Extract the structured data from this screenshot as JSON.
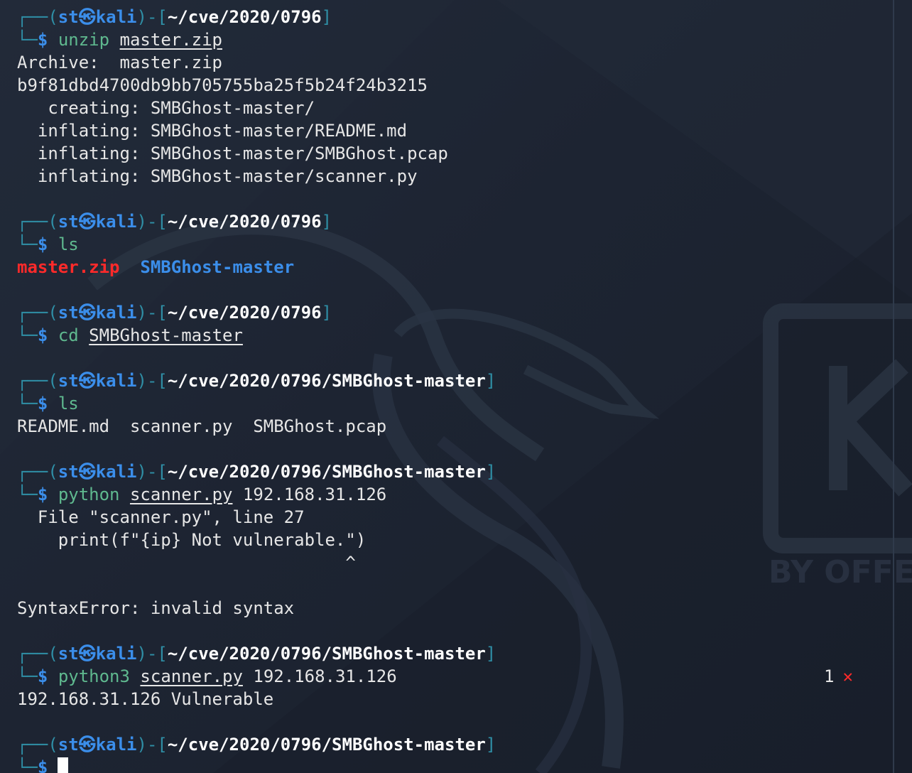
{
  "prompt": {
    "open": "┌──(",
    "user": "st",
    "at": "㉿",
    "host": "kali",
    "mid": ")-[",
    "close": "]",
    "corner": "└─",
    "dollar": "$"
  },
  "blocks": [
    {
      "path": "~/cve/2020/0796",
      "command": "unzip",
      "args": [
        {
          "text": "master.zip",
          "underline": true
        }
      ],
      "output": [
        "Archive:  master.zip",
        "b9f81dbd4700db9bb705755ba25f5b24f24b3215",
        "   creating: SMBGhost-master/",
        "  inflating: SMBGhost-master/README.md",
        "  inflating: SMBGhost-master/SMBGhost.pcap",
        "  inflating: SMBGhost-master/scanner.py"
      ]
    },
    {
      "path": "~/cve/2020/0796",
      "command": "ls",
      "args": [],
      "listing": [
        {
          "text": "master.zip",
          "kind": "zip"
        },
        {
          "text": "SMBGhost-master",
          "kind": "dir"
        }
      ]
    },
    {
      "path": "~/cve/2020/0796",
      "command": "cd",
      "args": [
        {
          "text": "SMBGhost-master",
          "underline": true
        }
      ],
      "output": []
    },
    {
      "path": "~/cve/2020/0796/SMBGhost-master",
      "command": "ls",
      "args": [],
      "output": [
        "README.md  scanner.py  SMBGhost.pcap"
      ]
    },
    {
      "path": "~/cve/2020/0796/SMBGhost-master",
      "command": "python",
      "args": [
        {
          "text": "scanner.py",
          "underline": true
        },
        {
          "text": "192.168.31.126",
          "underline": false
        }
      ],
      "output": [
        "  File \"scanner.py\", line 27",
        "    print(f\"{ip} Not vulnerable.\")",
        "                                ^",
        "",
        "SyntaxError: invalid syntax"
      ]
    },
    {
      "path": "~/cve/2020/0796/SMBGhost-master",
      "command": "python3",
      "args": [
        {
          "text": "scanner.py",
          "underline": true
        },
        {
          "text": "192.168.31.126",
          "underline": false
        }
      ],
      "status": {
        "code": "1",
        "mark": "✕"
      },
      "output": [
        "192.168.31.126 Vulnerable"
      ]
    },
    {
      "path": "~/cve/2020/0796/SMBGhost-master",
      "command": "",
      "args": [],
      "cursor": true,
      "last": true
    }
  ],
  "colors": {
    "background": "#1d2432",
    "prompt_frame": "#2f8fa6",
    "prompt_user": "#3b8eea",
    "command": "#5fb98f",
    "error_mark": "#ff2a2a",
    "zip_file": "#ff2a2a",
    "directory": "#3b8eea"
  }
}
